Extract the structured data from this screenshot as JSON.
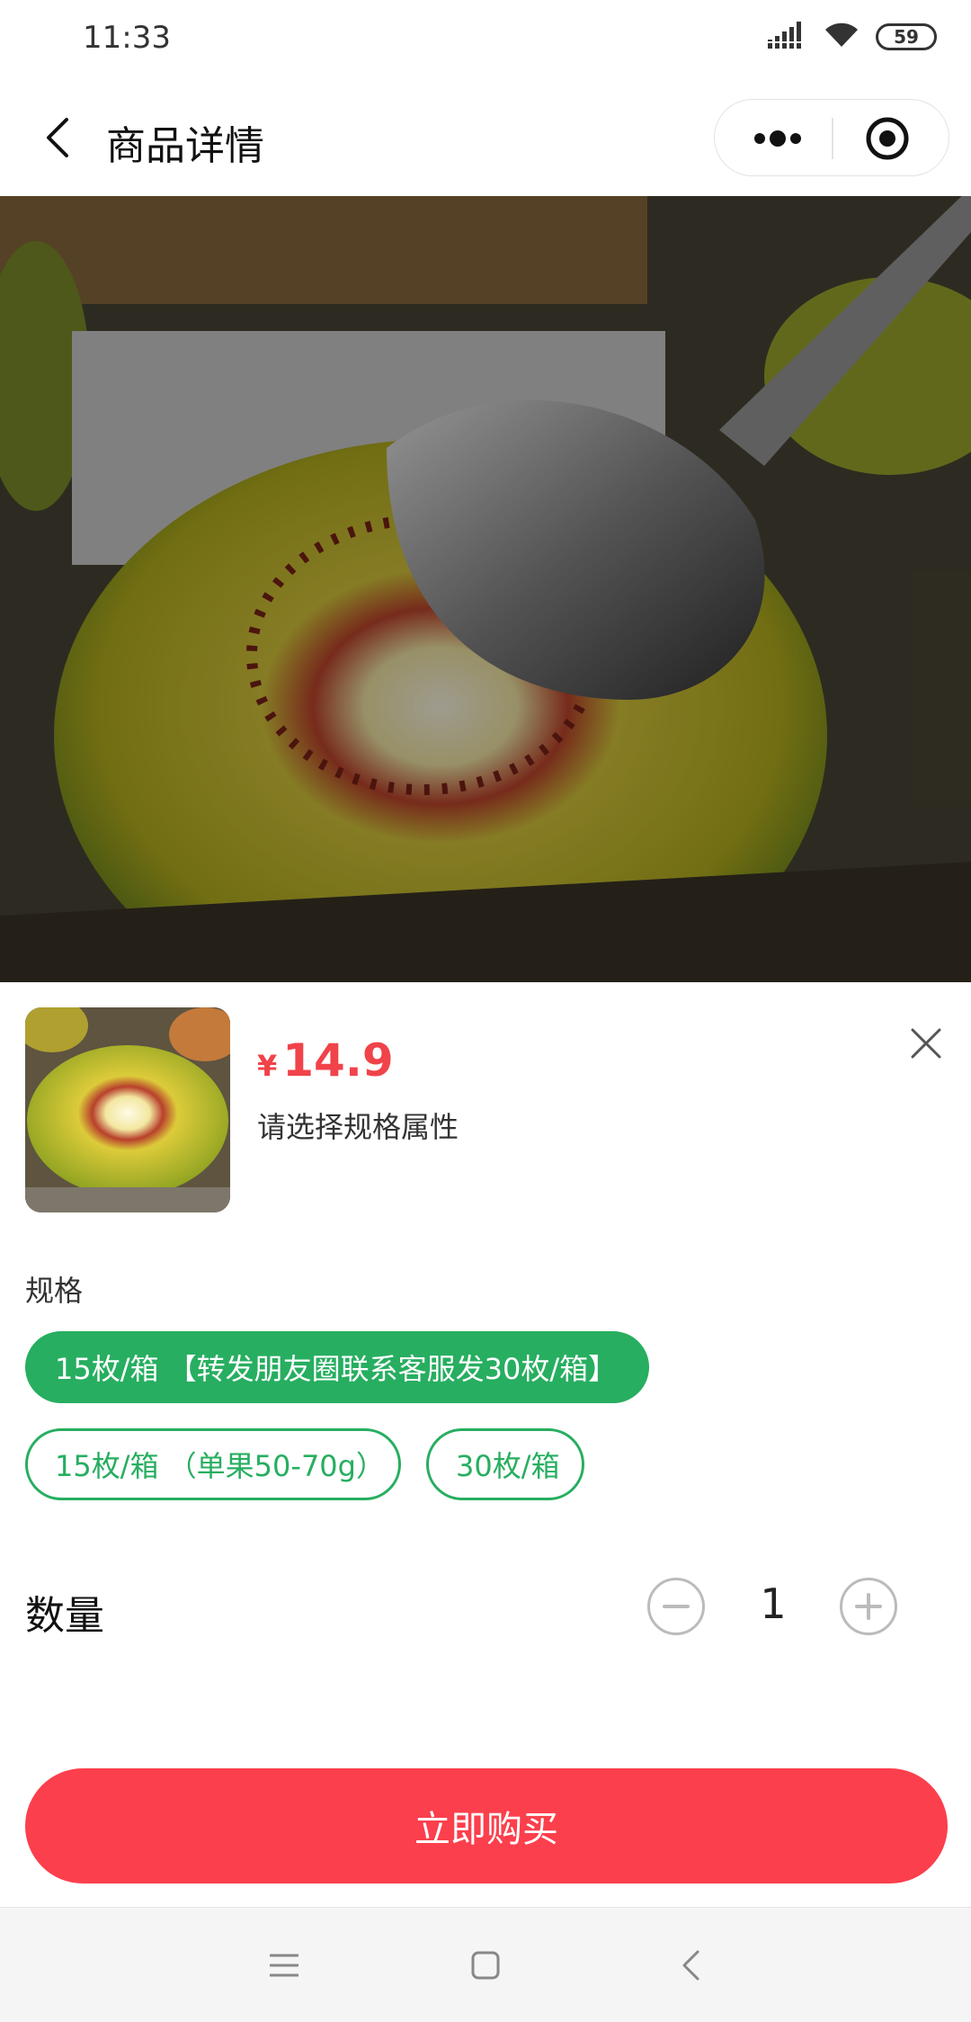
{
  "status_bar": {
    "time": "11:33",
    "battery": "59",
    "icons": [
      "signal-icon",
      "wifi-icon",
      "battery-icon"
    ]
  },
  "nav": {
    "title": "商品详情",
    "back_icon": "chevron-left-icon",
    "more_icon": "more-dots-icon",
    "close_icon": "target-close-icon"
  },
  "product": {
    "image_desc_icon": "kiwi-product-image",
    "currency": "¥",
    "price": "14.9",
    "hint": "请选择规格属性"
  },
  "spec": {
    "label": "规格",
    "options": [
      {
        "label": "15枚/箱 【转发朋友圈联系客服发30枚/箱】",
        "selected": true
      },
      {
        "label": "15枚/箱 （单果50-70g）",
        "selected": false
      },
      {
        "label": "30枚/箱",
        "selected": false
      }
    ]
  },
  "quantity": {
    "label": "数量",
    "value": "1"
  },
  "buy_button": "立即购买",
  "colors": {
    "accent_green": "#27ae60",
    "price_red": "#f0434a",
    "buy_red": "#fc3f4c"
  }
}
